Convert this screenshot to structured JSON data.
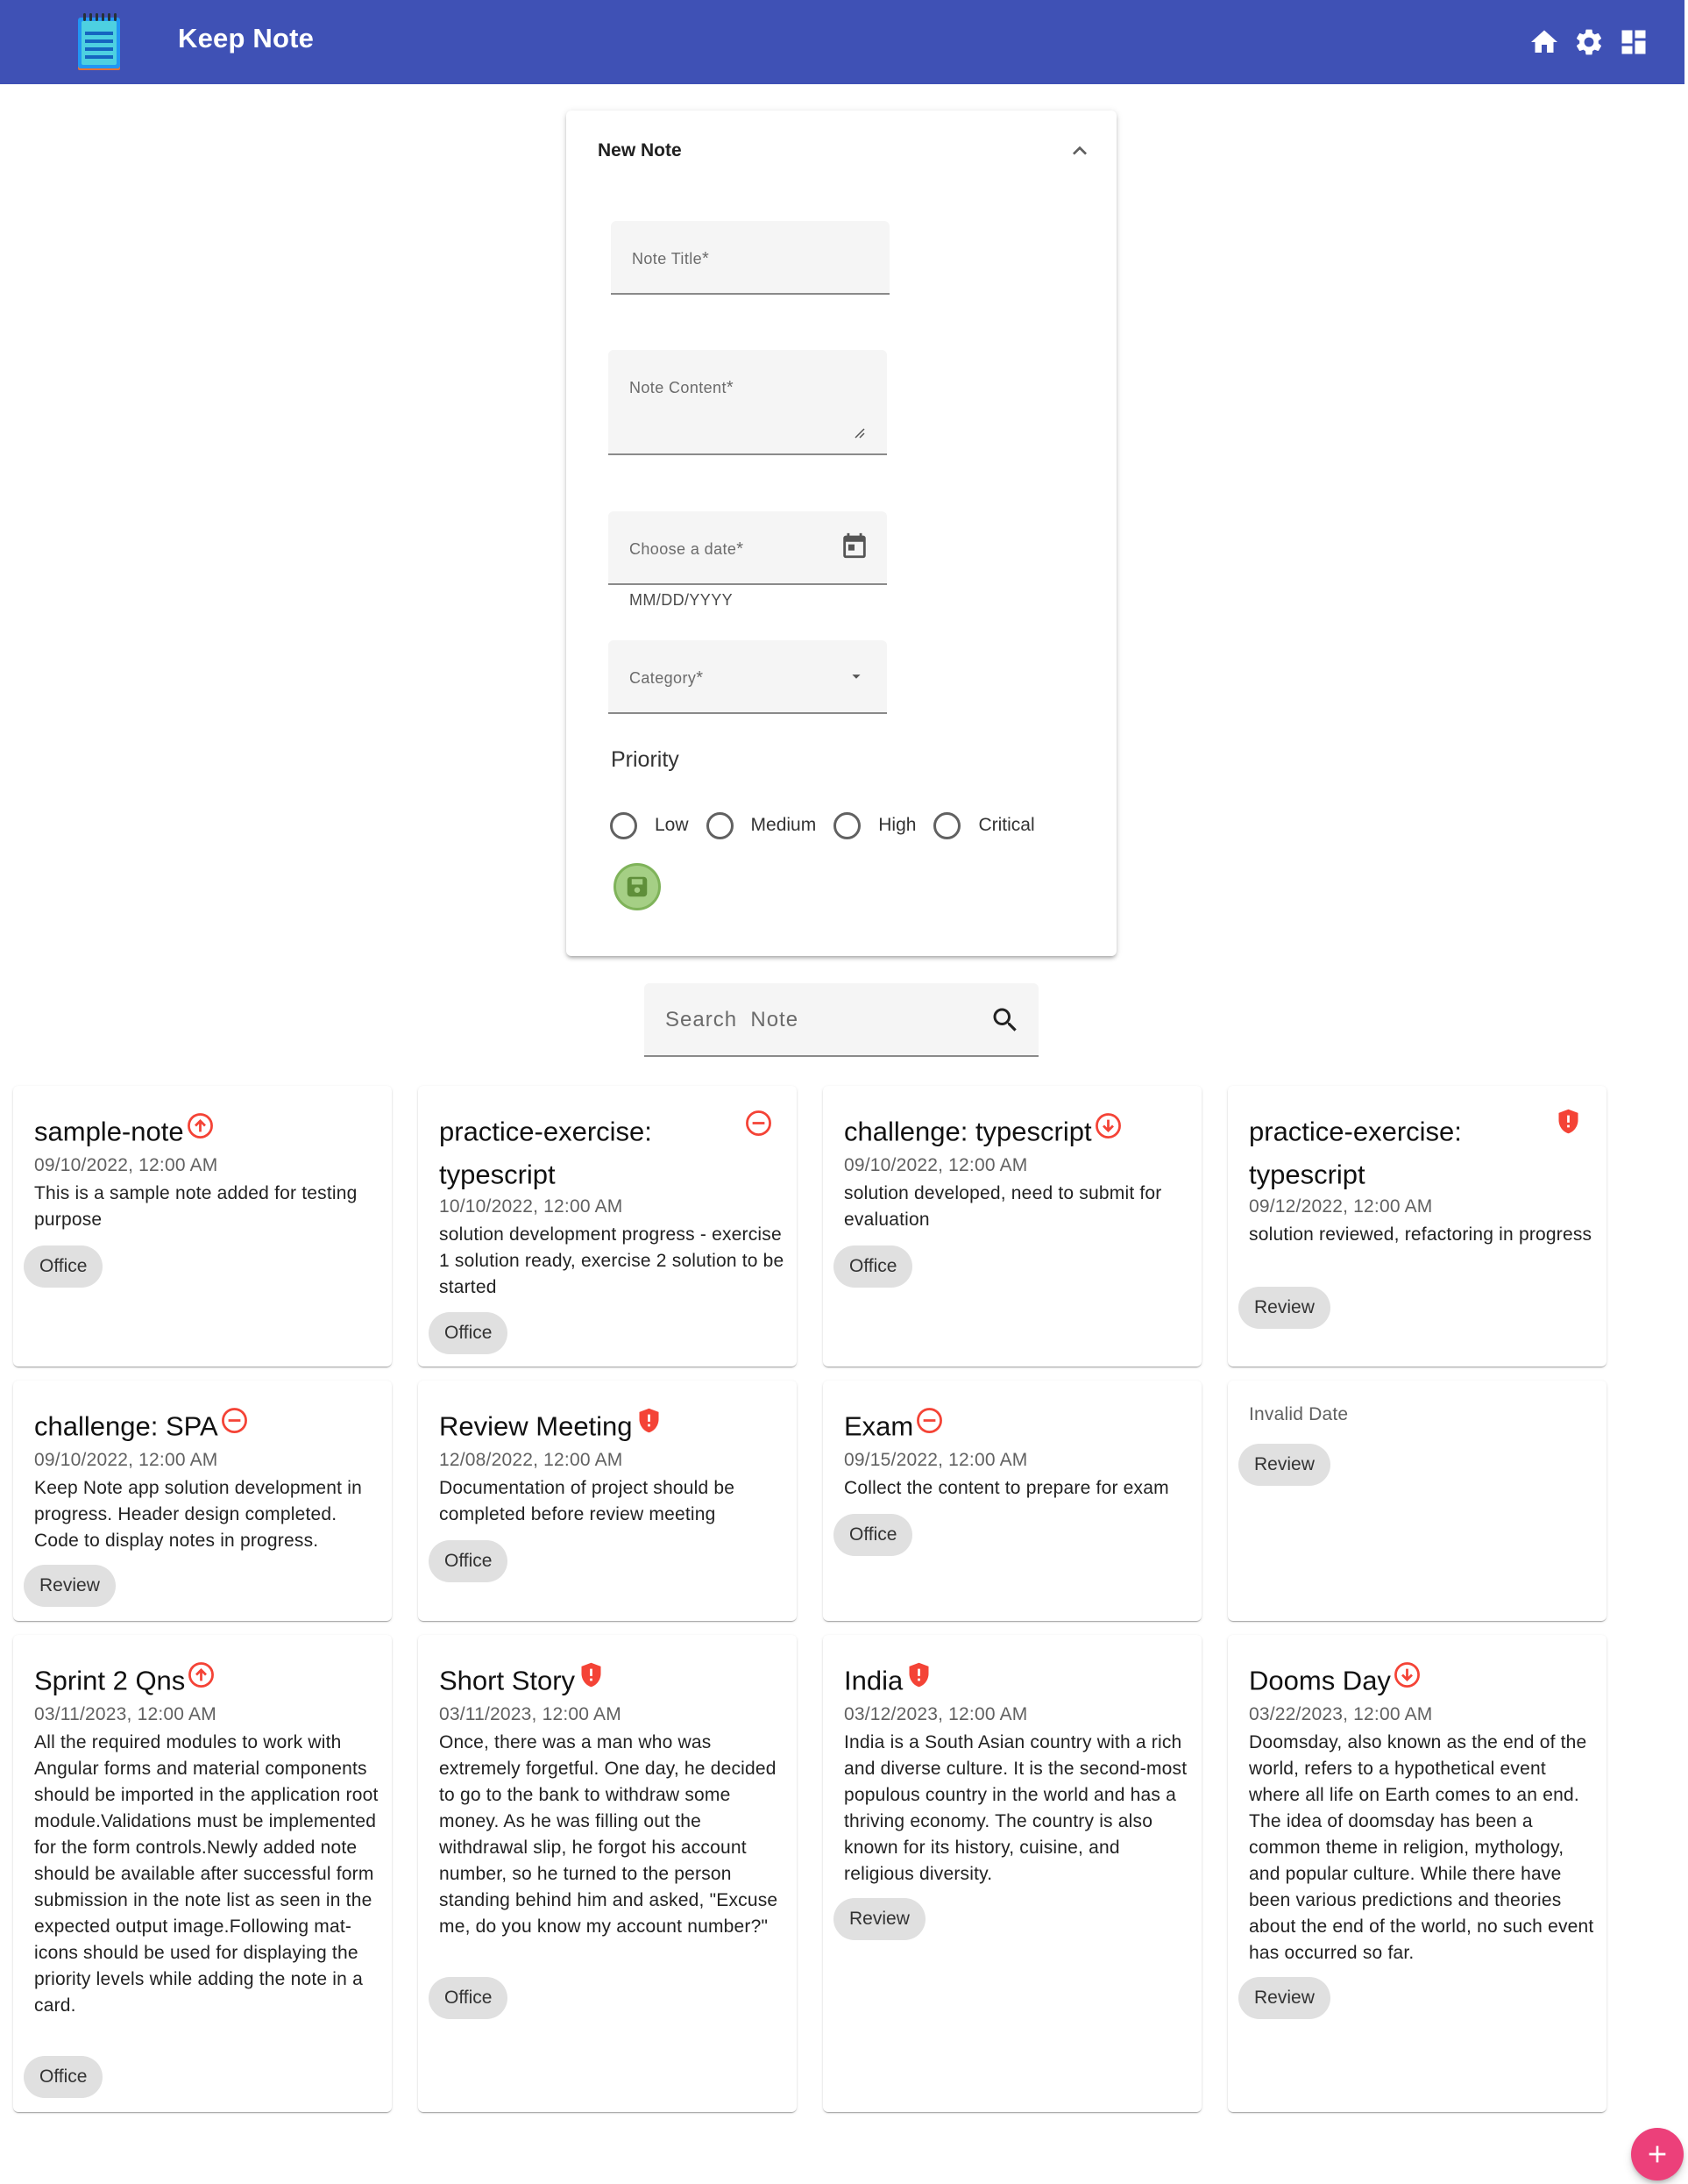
{
  "header": {
    "title": "Keep Note",
    "icons": [
      "notepad-logo-icon",
      "home-icon",
      "gear-icon",
      "dashboard-icon"
    ]
  },
  "form": {
    "panel_title": "New Note",
    "title_label": "Note Title",
    "content_label": "Note Content",
    "date_label": "Choose a date",
    "date_hint": "MM/DD/YYYY",
    "category_label": "Category",
    "required_mark": "*",
    "priority_label": "Priority",
    "priority_options": [
      "Low",
      "Medium",
      "High",
      "Critical"
    ]
  },
  "search": {
    "placeholder": "Search  Note"
  },
  "cards": [
    {
      "title": "sample-note",
      "priority": "high",
      "date": "09/10/2022, 12:00 AM",
      "text": "This is a sample note added for testing purpose",
      "category": "Office"
    },
    {
      "title": "practice-exercise: typescript",
      "priority": "medium",
      "date": "10/10/2022, 12:00 AM",
      "text": "solution development progress - exercise 1 solution ready, exercise 2 solution to be started",
      "category": "Office"
    },
    {
      "title": "challenge: typescript",
      "priority": "low",
      "date": "09/10/2022, 12:00 AM",
      "text": "solution developed, need to submit for evaluation",
      "category": "Office"
    },
    {
      "title": "practice-exercise: typescript",
      "priority": "critical",
      "date": "09/12/2022, 12:00 AM",
      "text": "solution reviewed, refactoring in progress",
      "category": "Review"
    },
    {
      "title": "challenge: SPA",
      "priority": "medium",
      "date": "09/10/2022, 12:00 AM",
      "text": "Keep Note app solution development in progress. Header design completed. Code to display notes in progress.",
      "category": "Review"
    },
    {
      "title": "Review Meeting",
      "priority": "critical",
      "date": "12/08/2022, 12:00 AM",
      "text": "Documentation of project should be completed before review meeting",
      "category": "Office"
    },
    {
      "title": "Exam",
      "priority": "medium",
      "date": "09/15/2022, 12:00 AM",
      "text": "Collect the content to prepare for exam",
      "category": "Office"
    },
    {
      "title": "",
      "priority": "",
      "date": "Invalid Date",
      "text": "",
      "category": "Review"
    },
    {
      "title": "Sprint 2 Qns",
      "priority": "high",
      "date": "03/11/2023, 12:00 AM",
      "text": "All the required modules to work with Angular forms and material components should be imported in the application root module.Validations must be implemented for the form controls.Newly added note should be available after successful form submission in the note list as seen in the expected output image.Following mat-icons should be used for displaying the priority levels while adding the note in a card.",
      "category": "Office"
    },
    {
      "title": "Short Story",
      "priority": "critical",
      "date": "03/11/2023, 12:00 AM",
      "text": "Once, there was a man who was extremely forgetful. One day, he decided to go to the bank to withdraw some money. As he was filling out the withdrawal slip, he forgot his account number, so he turned to the person standing behind him and asked, \"Excuse me, do you know my account number?\"",
      "category": "Office"
    },
    {
      "title": "India",
      "priority": "critical",
      "date": "03/12/2023, 12:00 AM",
      "text": "India is a South Asian country with a rich and diverse culture. It is the second-most populous country in the world and has a thriving economy. The country is also known for its history, cuisine, and religious diversity.",
      "category": "Review"
    },
    {
      "title": "Dooms Day",
      "priority": "low",
      "date": "03/22/2023, 12:00 AM",
      "text": "Doomsday, also known as the end of the world, refers to a hypothetical event where all life on Earth comes to an end. The idea of doomsday has been a common theme in religion, mythology, and popular culture. While there have been various predictions and theories about the end of the world, no such event has occurred so far.",
      "category": "Review"
    }
  ],
  "colors": {
    "toolbar": "#3f51b5",
    "priority_icon": "#f44336",
    "fab": "#ec407a",
    "save_fab": "#a5cf85"
  }
}
